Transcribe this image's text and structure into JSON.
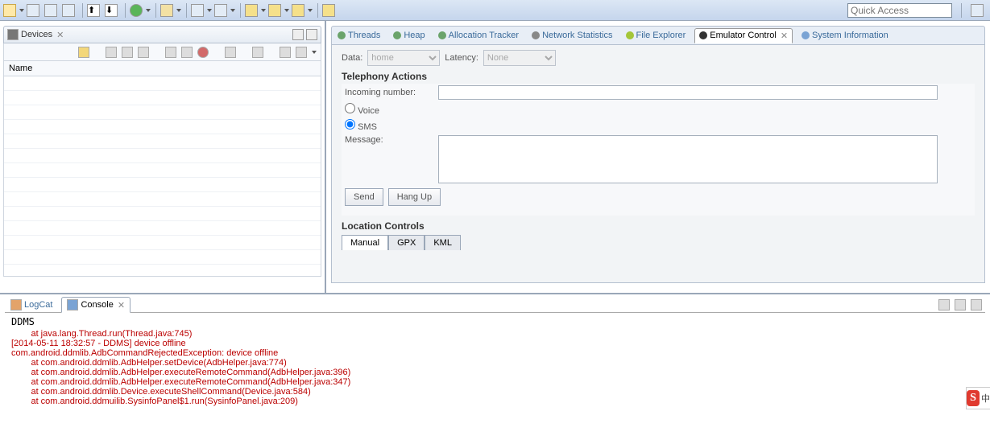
{
  "toolbar": {
    "quick_access_placeholder": "Quick Access"
  },
  "devices": {
    "tab_label": "Devices",
    "column_name": "Name"
  },
  "tabs": {
    "threads": "Threads",
    "heap": "Heap",
    "allocation": "Allocation Tracker",
    "network": "Network Statistics",
    "file_explorer": "File Explorer",
    "emulator": "Emulator Control",
    "sysinfo": "System Information"
  },
  "emu": {
    "data_label": "Data:",
    "data_value": "home",
    "latency_label": "Latency:",
    "latency_value": "None",
    "telephony_title": "Telephony Actions",
    "incoming_label": "Incoming number:",
    "voice_label": "Voice",
    "sms_label": "SMS",
    "message_label": "Message:",
    "send_btn": "Send",
    "hangup_btn": "Hang Up",
    "location_title": "Location Controls",
    "loc_manual": "Manual",
    "loc_gpx": "GPX",
    "loc_kml": "KML"
  },
  "bottom": {
    "logcat": "LogCat",
    "console": "Console",
    "console_title": "DDMS",
    "lines": [
      "\tat java.lang.Thread.run(Thread.java:745)",
      "",
      "[2014-05-11 18:32:57 - DDMS] device offline",
      "com.android.ddmlib.AdbCommandRejectedException: device offline",
      "\tat com.android.ddmlib.AdbHelper.setDevice(AdbHelper.java:774)",
      "\tat com.android.ddmlib.AdbHelper.executeRemoteCommand(AdbHelper.java:396)",
      "\tat com.android.ddmlib.AdbHelper.executeRemoteCommand(AdbHelper.java:347)",
      "\tat com.android.ddmlib.Device.executeShellCommand(Device.java:584)",
      "\tat com.android.ddmuilib.SysinfoPanel$1.run(SysinfoPanel.java:209)"
    ]
  },
  "ime": {
    "s": "S",
    "lang": "中"
  }
}
